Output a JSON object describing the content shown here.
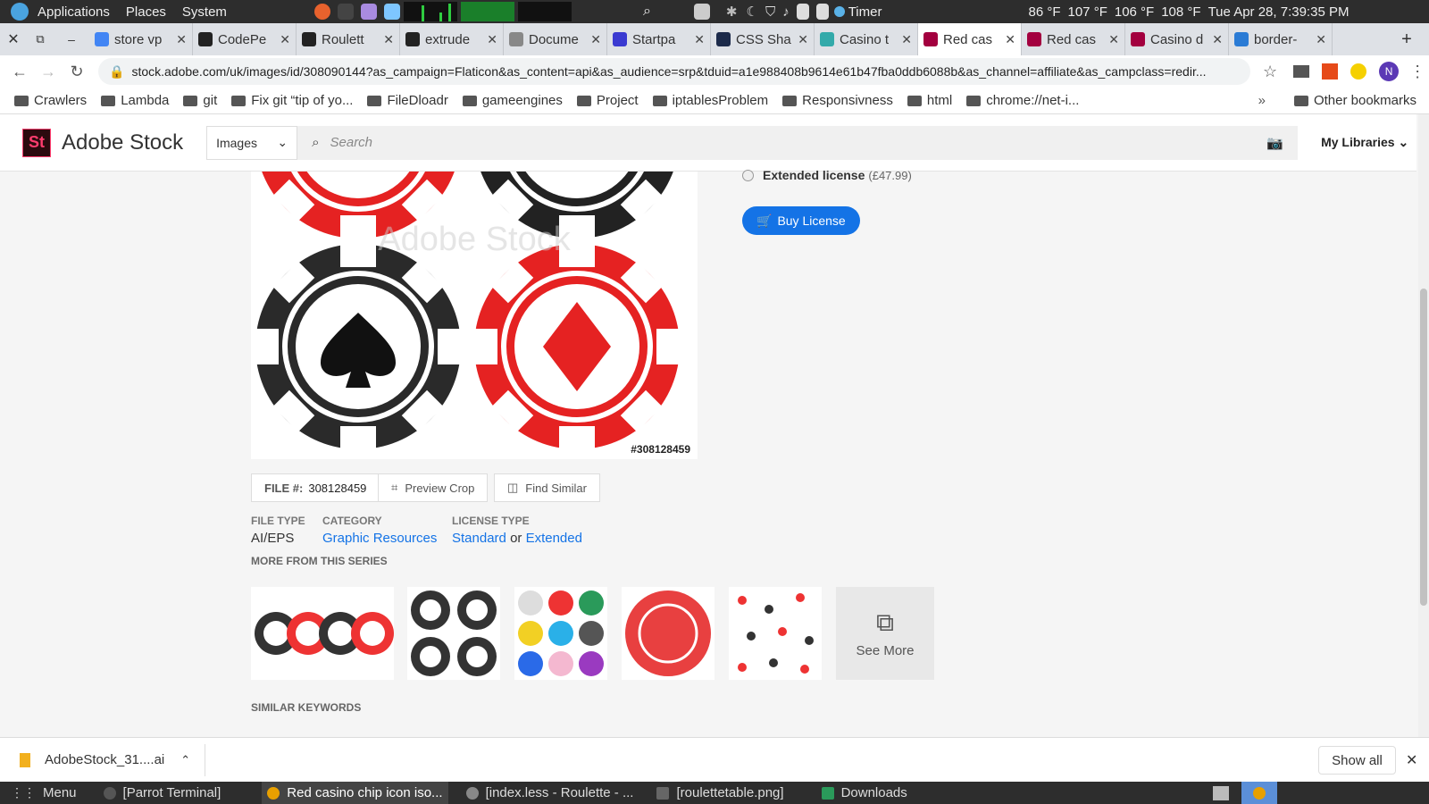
{
  "system_bar": {
    "menus": [
      "Applications",
      "Places",
      "System"
    ],
    "timer_label": "Timer",
    "temps": [
      "86 °F",
      "107 °F",
      "106 °F",
      "108 °F"
    ],
    "clock": "Tue Apr 28, 7:39:35 PM"
  },
  "tabs": [
    {
      "label": "store vp",
      "color": "#4285f4"
    },
    {
      "label": "CodePe",
      "color": "#222"
    },
    {
      "label": "Roulett",
      "color": "#222"
    },
    {
      "label": "extrude",
      "color": "#222"
    },
    {
      "label": "Docume",
      "color": "#888"
    },
    {
      "label": "Startpa",
      "color": "#3a3ad1"
    },
    {
      "label": "CSS Sha",
      "color": "#1c2a4a"
    },
    {
      "label": "Casino t",
      "color": "#3aa"
    },
    {
      "label": "Red cas",
      "color": "#a3003f",
      "active": true
    },
    {
      "label": "Red cas",
      "color": "#a3003f"
    },
    {
      "label": "Casino d",
      "color": "#a3003f"
    },
    {
      "label": "border-",
      "color": "#2a7bd5"
    }
  ],
  "address": {
    "url": "stock.adobe.com/uk/images/id/308090144?as_campaign=Flaticon&as_content=api&as_audience=srp&tduid=a1e988408b9614e61b47fba0ddb6088b&as_channel=affiliate&as_campclass=redir...",
    "profile_initial": "N"
  },
  "bookmarks": [
    "Crawlers",
    "Lambda",
    "git",
    "Fix git “tip of yo...",
    "FileDloadr",
    "gameengines",
    "Project",
    "iptablesProblem",
    "Responsivness",
    "html",
    "chrome://net-i..."
  ],
  "bookmarks_more": "»",
  "bookmarks_other": "Other bookmarks",
  "stock": {
    "logo": "St",
    "brand": "Adobe Stock",
    "category": "Images",
    "search_placeholder": "Search",
    "my_libraries": "My Libraries"
  },
  "license": {
    "extended_label": "Extended license",
    "extended_price": "(£47.99)",
    "buy_label": "Buy License"
  },
  "preview": {
    "watermark": "Adobe Stock",
    "file_tag": "#308128459"
  },
  "actions": {
    "file_label": "FILE #:",
    "file_number": "308128459",
    "preview_crop": "Preview Crop",
    "find_similar": "Find Similar"
  },
  "meta": {
    "file_type_label": "FILE TYPE",
    "file_type": "AI/EPS",
    "category_label": "CATEGORY",
    "category": "Graphic Resources",
    "license_type_label": "LICENSE TYPE",
    "license_standard": "Standard",
    "license_or": "or",
    "license_extended": "Extended"
  },
  "series": {
    "title": "MORE FROM THIS SERIES",
    "see_more": "See More"
  },
  "similar_keywords": "SIMILAR KEYWORDS",
  "download": {
    "filename": "AdobeStock_31....ai",
    "show_all": "Show all"
  },
  "taskbar": {
    "menu": "Menu",
    "items": [
      "[Parrot Terminal]",
      "Red casino chip icon iso...",
      "[index.less - Roulette - ...",
      "[roulettetable.png]",
      "Downloads"
    ]
  }
}
